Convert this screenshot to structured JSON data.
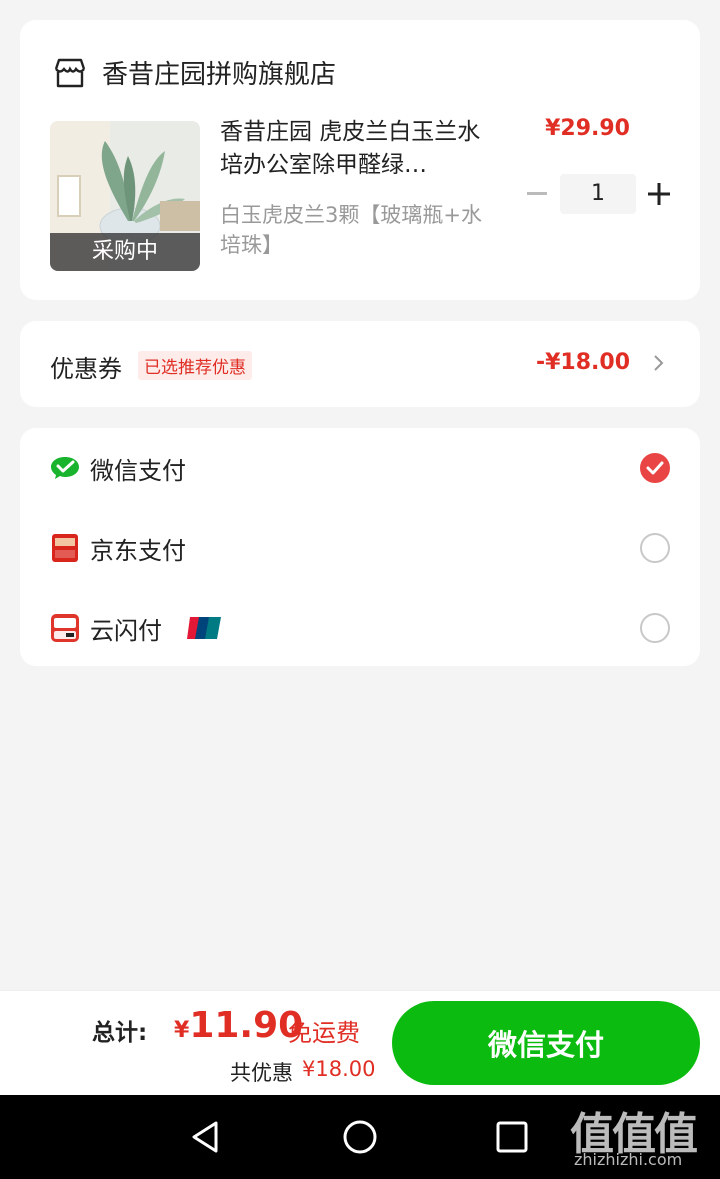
{
  "store": {
    "name": "香昔庄园拼购旗舰店",
    "icon": "shop-icon"
  },
  "product": {
    "title": "香昔庄园 虎皮兰白玉兰水培办公室除甲醛绿…",
    "spec": "白玉虎皮兰3颗【玻璃瓶+水培珠】",
    "price": "¥29.90",
    "image_tag": "采购中",
    "quantity": "1"
  },
  "coupon": {
    "label": "优惠券",
    "tag": "已选推荐优惠",
    "amount": "-¥18.00"
  },
  "payment": {
    "methods": [
      {
        "label": "微信支付",
        "icon": "wechat-pay-icon",
        "selected": true
      },
      {
        "label": "京东支付",
        "icon": "jd-pay-icon",
        "selected": false
      },
      {
        "label": "云闪付",
        "icon": "cloud-quickpay-icon",
        "selected": false,
        "badge": "unionpay-badge-icon"
      }
    ]
  },
  "summary": {
    "total_label": "总计:",
    "total_currency": "¥",
    "total_value": "11.90",
    "shipping": "免运费",
    "saved_label": "共优惠",
    "saved_value": "¥18.00",
    "pay_button": "微信支付"
  },
  "watermark": {
    "big": "值值值",
    "small": "zhizhizhi.com"
  },
  "colors": {
    "accent_red": "#e02e24",
    "wechat_green": "#0cbb0f",
    "radio_checked": "#e94545"
  }
}
